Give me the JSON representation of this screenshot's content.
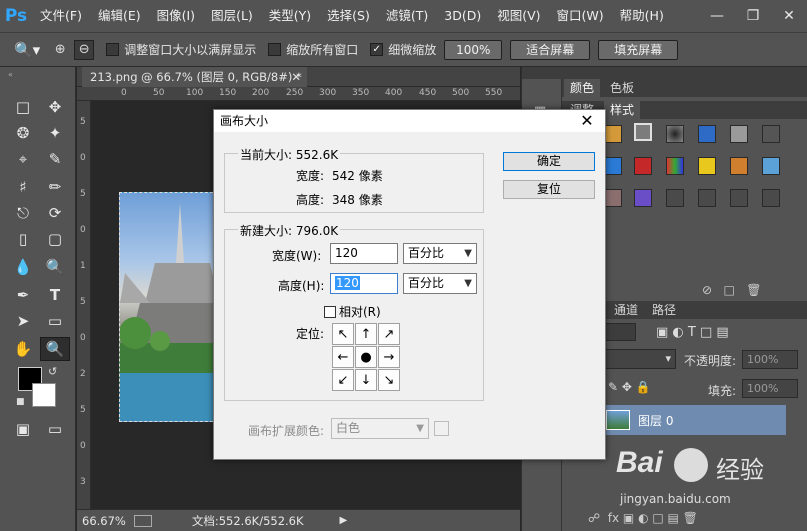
{
  "app": {
    "logo": "Ps",
    "menu": [
      "文件(F)",
      "编辑(E)",
      "图像(I)",
      "图层(L)",
      "类型(Y)",
      "选择(S)",
      "滤镜(T)",
      "3D(D)",
      "视图(V)",
      "窗口(W)",
      "帮助(H)"
    ]
  },
  "options": {
    "resize_windows": "调整窗口大小以满屏显示",
    "zoom_all": "缩放所有窗口",
    "scrubby_zoom": "细微缩放",
    "zoom_100": "100%",
    "fit_screen": "适合屏幕",
    "fill_screen": "填充屏幕"
  },
  "document": {
    "tab_title": "213.png @ 66.7% (图层 0, RGB/8#) *",
    "ruler_top": [
      "0",
      "50",
      "100",
      "150",
      "200",
      "250",
      "300",
      "350",
      "400",
      "450",
      "500",
      "550"
    ],
    "ruler_left": [
      "5",
      "0",
      "5",
      "0",
      "1",
      "5",
      "0",
      "2",
      "5",
      "0",
      "3"
    ],
    "zoom": "66.67%",
    "doc_info": "文档:552.6K/552.6K"
  },
  "panels": {
    "tab_color": "颜色",
    "tab_swatches": "色板",
    "tab_adjust": "调整",
    "tab_styles": "样式",
    "tab_channels": "通道",
    "tab_paths": "路径",
    "opacity_label": "不透明度:",
    "opacity_value": "100%",
    "fill_label": "填充:",
    "fill_value": "100%",
    "layer_name": "图层 0"
  },
  "dialog": {
    "title": "画布大小",
    "current_size_label": "当前大小: 552.6K",
    "width_label": "宽度:",
    "width_value": "542 像素",
    "height_label": "高度:",
    "height_value": "348 像素",
    "new_size_label": "新建大小: 796.0K",
    "new_width_label": "宽度(W):",
    "new_width_value": "120",
    "new_width_unit": "百分比",
    "new_height_label": "高度(H):",
    "new_height_value": "120",
    "new_height_unit": "百分比",
    "relative_label": "相对(R)",
    "anchor_label": "定位:",
    "ok": "确定",
    "reset": "复位",
    "ext_color_label": "画布扩展颜色:",
    "ext_color_value": "白色"
  },
  "watermark": {
    "brand": "Bai",
    "suffix": "经验",
    "url": "jingyan.baidu.com"
  }
}
